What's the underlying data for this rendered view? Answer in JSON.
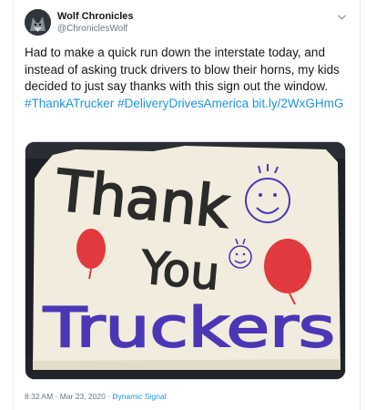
{
  "tweet": {
    "author": {
      "display_name": "Wolf Chronicles",
      "handle": "@ChroniclesWolf"
    },
    "text": "Had to make a quick run down the interstate today, and instead of asking truck drivers to blow their horns, my kids decided to just say thanks with this sign out the window.",
    "hashtags": [
      "#ThankATrucker",
      "#DeliveryDrivesAmerica"
    ],
    "link": "bit.ly/2WxGHmG",
    "sign_text": {
      "line1": "Thank",
      "line2": "You",
      "line3": "Truckers"
    },
    "timestamp": "8:32 AM · Mar 23, 2020",
    "separator": " · ",
    "source": "Dynamic Signal",
    "icons": {
      "menu": "chevron-down-icon"
    },
    "colors": {
      "link": "#1b95e0",
      "text": "#14171a",
      "meta": "#657786"
    }
  }
}
